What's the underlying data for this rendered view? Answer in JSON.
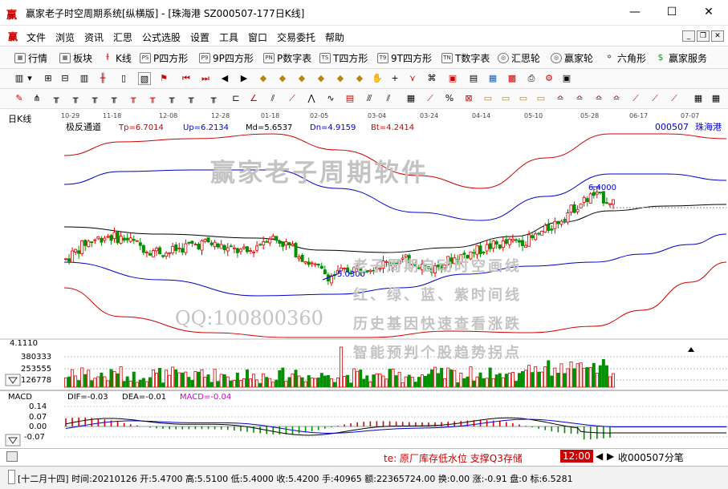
{
  "window": {
    "title": "赢家老子时空周期系统[纵横版] - [珠海港  SZ000507-177日K线]",
    "minimize": "—",
    "maximize": "☐",
    "close": "✕"
  },
  "menu": {
    "items": [
      "文件",
      "浏览",
      "资讯",
      "汇思",
      "公式选股",
      "设置",
      "工具",
      "窗口",
      "交易委托",
      "帮助"
    ]
  },
  "toolbar1": {
    "items": [
      {
        "label": "行情",
        "icon": "grid-icon"
      },
      {
        "label": "板块",
        "icon": "grid-icon"
      },
      {
        "label": "K线",
        "icon": "candlestick-icon"
      },
      {
        "label": "P四方形",
        "icon": "ps-icon"
      },
      {
        "label": "9P四方形",
        "icon": "p9-icon"
      },
      {
        "label": "P数字表",
        "icon": "pn-icon"
      },
      {
        "label": "T四方形",
        "icon": "ts-icon"
      },
      {
        "label": "9T四方形",
        "icon": "t9-icon"
      },
      {
        "label": "T数字表",
        "icon": "tn-icon"
      },
      {
        "label": "汇思轮",
        "icon": "wheel-icon"
      },
      {
        "label": "赢家轮",
        "icon": "wheel-icon"
      },
      {
        "label": "六角形",
        "icon": "hexagram-icon"
      },
      {
        "label": "赢家服务",
        "icon": "dollar-icon"
      }
    ]
  },
  "chart": {
    "period_label": "日K线",
    "indicator_name": "极反通道",
    "params": {
      "tp": "Tp=6.7014",
      "up": "Up=6.2134",
      "md": "Md=5.6537",
      "dn": "Dn=4.9159",
      "bt": "Bt=4.2414"
    },
    "code_label": "000507",
    "name_label": "珠海港",
    "date_ticks": [
      "10-29",
      "11-18",
      "12-08",
      "12-28",
      "01-18",
      "02-05",
      "03-04",
      "03-24",
      "04-14",
      "05-10",
      "05-28",
      "06-17",
      "07-07"
    ],
    "high_annotation": "6.4000",
    "low_annotation": "5.0300",
    "price_axis_label": "4.1110",
    "volume_ticks": [
      "380333",
      "253555",
      "126778"
    ],
    "watermark_title": "赢家老子周期软件",
    "watermark_qq": "QQ:100800360",
    "watermark_lines": [
      "老子周期自动时空画线",
      "红、绿、蓝、紫时间线",
      "历史基因快速查看涨跌",
      "智能预判个股趋势拐点"
    ]
  },
  "macd": {
    "label": "MACD",
    "dif": "DIF=-0.03",
    "dea": "DEA=-0.01",
    "macd": "MACD=-0.04",
    "ticks": [
      "0.14",
      "0.07",
      "0.00",
      "-0.07"
    ]
  },
  "ticker": {
    "news": "te:  原厂库存低水位 支撑Q3存储",
    "time": "12:00",
    "receive": "收000507分笔"
  },
  "status": {
    "text": "[十二月十四] 时间:20210126 开:5.4700 高:5.5100 低:5.4000 收:5.4200 手:40965 额:22365724.00 换:0.00 涨:-0.91 盘:0 标:6.5281"
  },
  "colors": {
    "candle_up": "#e00000",
    "candle_down": "#009000",
    "channel_outer": "#d00000",
    "channel_inner": "#0000c8",
    "channel_mid": "#000000",
    "annotation": "#0000c8",
    "watermark": "#c3c3c3"
  },
  "chart_data": [
    {
      "type": "candlestick",
      "title": "极反通道",
      "x_ticks": [
        "10-29",
        "11-18",
        "12-08",
        "12-28",
        "01-18",
        "02-05",
        "03-04",
        "03-24",
        "04-14",
        "05-10",
        "05-28",
        "06-17",
        "07-07"
      ],
      "indicators": {
        "Tp": 6.7014,
        "Up": 6.2134,
        "Md": 5.6537,
        "Dn": 4.9159,
        "Bt": 4.2414
      },
      "annotations": [
        {
          "label": "6.4000",
          "kind": "high"
        },
        {
          "label": "5.0300",
          "kind": "low"
        }
      ],
      "ohlc_trend": [
        5.35,
        5.6,
        5.7,
        5.65,
        5.5,
        5.45,
        5.55,
        5.6,
        5.5,
        5.45,
        5.7,
        5.55,
        5.3,
        5.1,
        5.2,
        5.25,
        5.3,
        5.35,
        5.2,
        5.35,
        5.45,
        5.55,
        5.6,
        5.65,
        5.85,
        6.1,
        6.3,
        6.2
      ]
    },
    {
      "type": "bar",
      "title": "volume",
      "y_ticks": [
        126778,
        253555,
        380333
      ]
    },
    {
      "type": "line",
      "title": "MACD",
      "series": [
        {
          "name": "DIF",
          "last": -0.03
        },
        {
          "name": "DEA",
          "last": -0.01
        },
        {
          "name": "MACD",
          "last": -0.04
        }
      ],
      "y_ticks": [
        0.14,
        0.07,
        0.0,
        -0.07
      ]
    }
  ]
}
